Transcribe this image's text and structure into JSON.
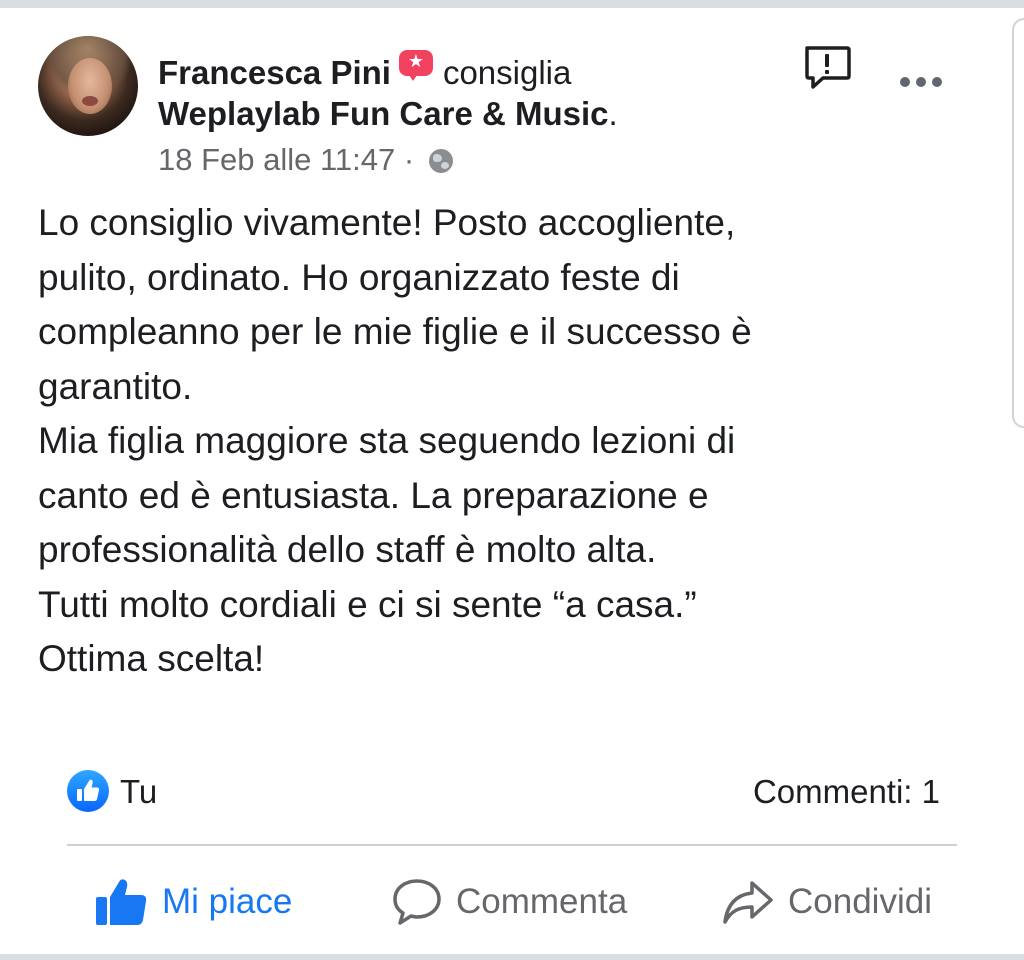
{
  "post": {
    "author": "Francesca Pini",
    "action_verb": "consiglia",
    "page_name": "Weplaylab Fun Care & Music",
    "page_suffix": ".",
    "timestamp": "18 Feb alle 11:47",
    "separator": "·",
    "audience_icon": "globe-icon",
    "recommend_icon": "recommend-star-icon",
    "text_lines": [
      "Lo consiglio vivamente! Posto accogliente,",
      "pulito, ordinato. Ho organizzato feste di",
      "compleanno per le mie figlie e il successo è",
      "garantito.",
      "Mia figlia maggiore sta seguendo lezioni di",
      "canto ed è entusiasta. La preparazione e",
      "professionalità dello staff è molto alta.",
      "Tutti molto cordiali e ci si sente “a casa.”",
      "Ottima scelta!"
    ]
  },
  "reactions": {
    "reactors": "Tu",
    "comments": "Commenti: 1",
    "reaction_icon": "like-reaction-icon"
  },
  "actions": {
    "like_label": "Mi piace",
    "comment_label": "Commenta",
    "share_label": "Condividi"
  },
  "colors": {
    "accent": "#1877f2",
    "recommend": "#f3425f",
    "secondary_text": "#65676b",
    "primary_text": "#1c1e21",
    "divider": "#ced0d4"
  }
}
